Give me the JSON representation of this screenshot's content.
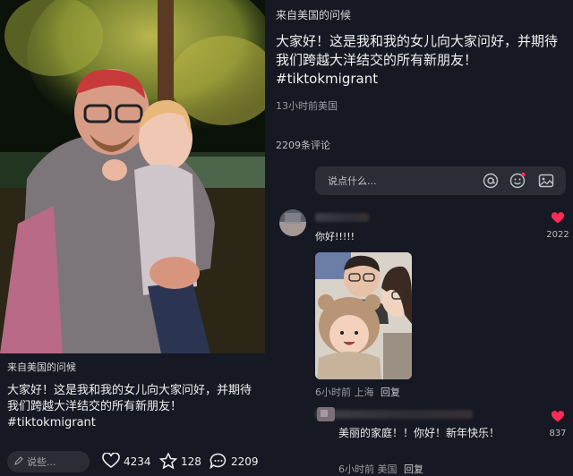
{
  "left_post": {
    "greeting": "来自美国的问候",
    "caption": "大家好！这是我和我的女儿向大家问好，并期待我们跨越大洋结交的所有新朋友！#tiktokmigrant",
    "say_placeholder": "说些...",
    "likes": "4234",
    "favorites": "128",
    "comments": "2209"
  },
  "right_post": {
    "greeting": "来自美国的问候",
    "caption": "大家好！这是我和我的女儿向大家问好，并期待我们跨越大洋结交的所有新朋友！#tiktokmigrant",
    "meta": "13小时前美国",
    "comment_count_label": "2209条评论",
    "comment_placeholder": "说点什么...",
    "comments": [
      {
        "text": "你好!!!!!",
        "likes": "2022",
        "meta": "6小时前 上海",
        "reply": "回复"
      },
      {
        "text": "美丽的家庭！！你好！新年快乐！",
        "likes": "837",
        "meta": "6小时前 美国",
        "reply": "回复"
      }
    ]
  },
  "colors": {
    "background": "#161823",
    "like_red": "#fe2c55",
    "panel_input": "#2a2c36"
  },
  "icons": [
    "pencil-icon",
    "heart-icon",
    "star-icon",
    "chat-bubble-icon",
    "at-icon",
    "emoji-icon",
    "image-icon"
  ]
}
